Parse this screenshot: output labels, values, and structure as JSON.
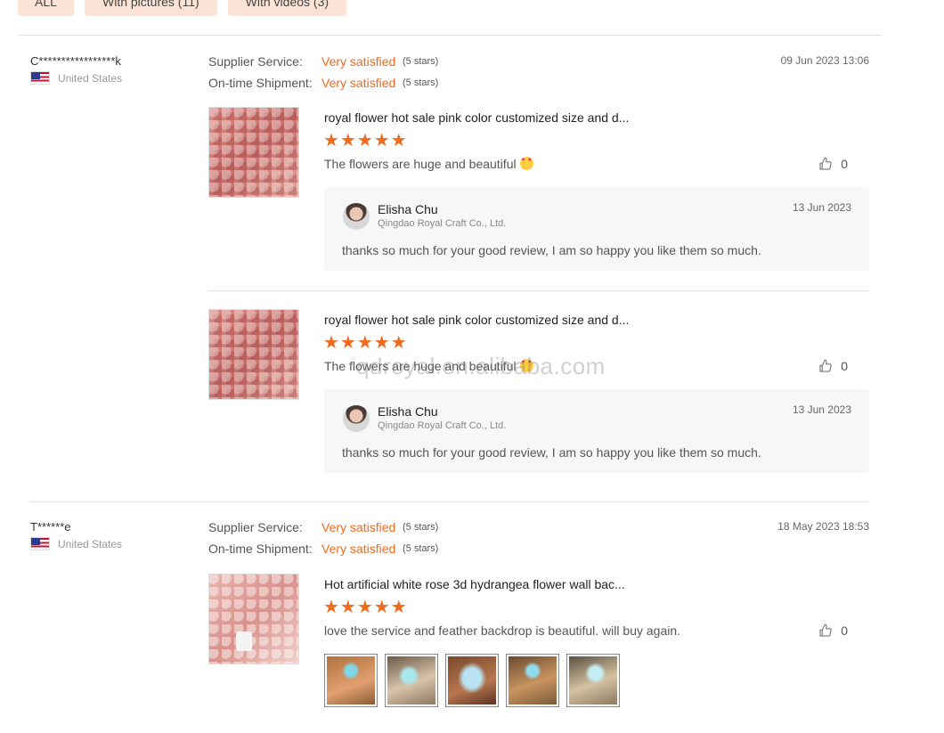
{
  "filters": [
    {
      "label": "ALL"
    },
    {
      "label": "With pictures (11)"
    },
    {
      "label": "With videos (3)"
    }
  ],
  "icons": {
    "like": "thumbs-up-icon",
    "flag": "us-flag-icon",
    "emoji": "heart-eyes-emoji-icon",
    "star": "star-icon"
  },
  "colors": {
    "accent": "#f06a1e",
    "filter_bg": "#fde3d5",
    "reply_bg": "#f6f7f9"
  },
  "watermark": "qdroyal.en.alibaba.com",
  "reviews": [
    {
      "reviewer": "C*****************k",
      "country": "United States",
      "date": "09 Jun 2023 13:06",
      "ratings": [
        {
          "label": "Supplier Service:",
          "value": "Very satisfied",
          "stars": "(5 stars)"
        },
        {
          "label": "On-time Shipment:",
          "value": "Very satisfied",
          "stars": "(5 stars)"
        }
      ],
      "products": [
        {
          "title": "royal flower hot sale pink color customized size and d...",
          "stars": "★★★★★",
          "star_count": 5,
          "text": "The flowers are huge and beautiful",
          "likes": "0",
          "reply": {
            "name": "Elisha Chu",
            "company": "Qingdao Royal Craft Co., Ltd.",
            "date": "13 Jun 2023",
            "text": "thanks so much for your good review, I am so happy you like them so much."
          }
        },
        {
          "title": "royal flower hot sale pink color customized size and d...",
          "stars": "★★★★★",
          "star_count": 5,
          "text": "The flowers are huge and beautiful",
          "likes": "0",
          "reply": {
            "name": "Elisha Chu",
            "company": "Qingdao Royal Craft Co., Ltd.",
            "date": "13 Jun 2023",
            "text": "thanks so much for your good review, I am so happy you like them so much."
          }
        }
      ]
    },
    {
      "reviewer": "T******e",
      "country": "United States",
      "date": "18 May 2023 18:53",
      "ratings": [
        {
          "label": "Supplier Service:",
          "value": "Very satisfied",
          "stars": "(5 stars)"
        },
        {
          "label": "On-time Shipment:",
          "value": "Very satisfied",
          "stars": "(5 stars)"
        }
      ],
      "products": [
        {
          "title": "Hot artificial white rose 3d hydrangea flower wall bac...",
          "stars": "★★★★★",
          "star_count": 5,
          "text": "love the service and feather backdrop is beautiful. will buy again.",
          "likes": "0",
          "gallery_count": 5
        }
      ]
    }
  ]
}
